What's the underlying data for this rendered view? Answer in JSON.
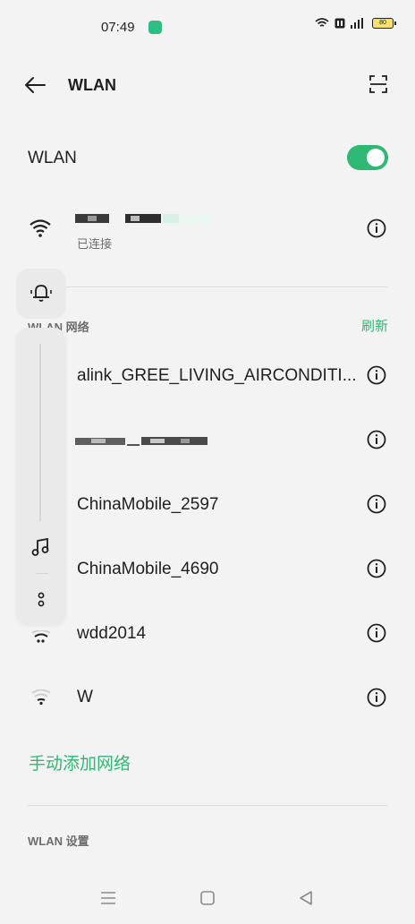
{
  "status_bar": {
    "time": "07:49",
    "battery_text": "80"
  },
  "header": {
    "title": "WLAN"
  },
  "wlan_toggle": {
    "label": "WLAN",
    "state": "on"
  },
  "connected": {
    "status": "已连接"
  },
  "section_networks": {
    "label": "WLAN 网络",
    "refresh_label": "刷新"
  },
  "networks": [
    {
      "name": "alink_GREE_LIVING_AIRCONDITI..."
    },
    {
      "name": ""
    },
    {
      "name": "ChinaMobile_2597"
    },
    {
      "name": "ChinaMobile_4690"
    },
    {
      "name": "wdd2014"
    },
    {
      "name": "W"
    }
  ],
  "add_network": {
    "label": "手动添加网络"
  },
  "section_settings": {
    "label": "WLAN 设置"
  },
  "colors": {
    "accent": "#2eb873",
    "background": "#f3f3f3"
  }
}
